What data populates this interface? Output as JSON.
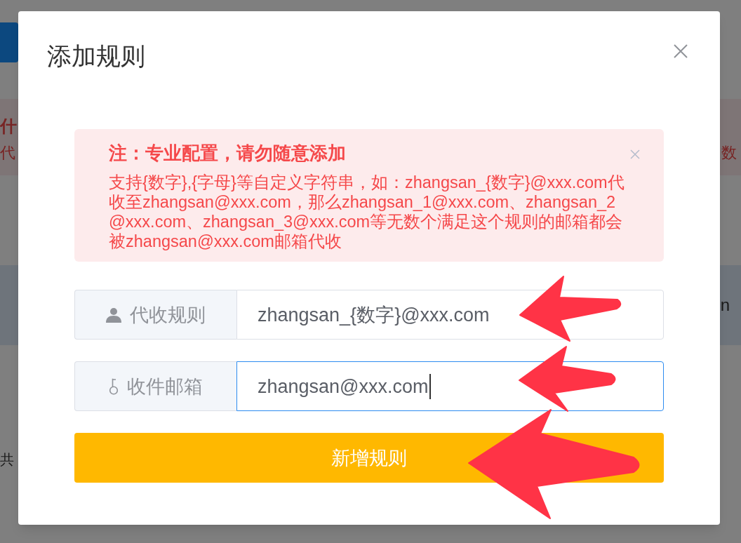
{
  "background_page": {
    "notice_title": "什",
    "notice_text_left": "代",
    "notice_text_right": "数",
    "row_text": "n",
    "footer_text": "共"
  },
  "dialog": {
    "title": "添加规则",
    "alert": {
      "title": "注：专业配置，请勿随意添加",
      "text": "支持{数字},{字母}等自定义字符串，如：zhangsan_{数字}@xxx.com代收至zhangsan@xxx.com，那么zhangsan_1@xxx.com、zhangsan_2@xxx.com、zhangsan_3@xxx.com等无数个满足这个规则的邮箱都会被zhangsan@xxx.com邮箱代收"
    },
    "fields": [
      {
        "label": "代收规则",
        "value": "zhangsan_{数字}@xxx.com",
        "focused": false
      },
      {
        "label": "收件邮箱",
        "value": "zhangsan@xxx.com",
        "focused": true
      }
    ],
    "submit_button": {
      "label": "新增规则"
    }
  }
}
